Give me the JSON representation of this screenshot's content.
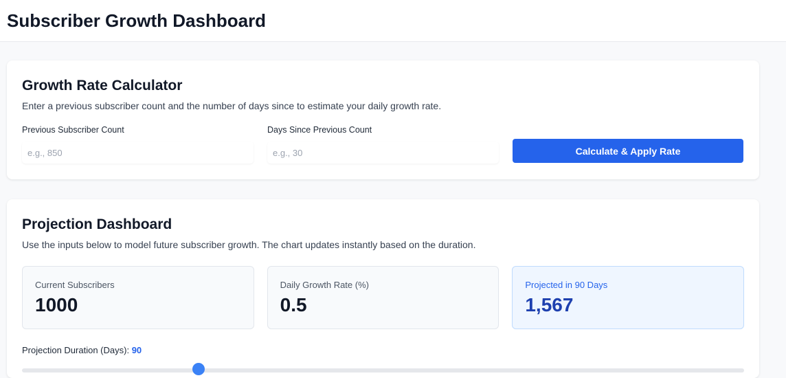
{
  "header": {
    "title": "Subscriber Growth Dashboard"
  },
  "calculator": {
    "title": "Growth Rate Calculator",
    "description": "Enter a previous subscriber count and the number of days since to estimate your daily growth rate.",
    "prev_count_label": "Previous Subscriber Count",
    "prev_count_placeholder": "e.g., 850",
    "days_label": "Days Since Previous Count",
    "days_placeholder": "e.g., 30",
    "button_label": "Calculate & Apply Rate"
  },
  "projection": {
    "title": "Projection Dashboard",
    "description": "Use the inputs below to model future subscriber growth. The chart updates instantly based on the duration.",
    "stats": [
      {
        "label": "Current Subscribers",
        "value": "1000"
      },
      {
        "label": "Daily Growth Rate (%)",
        "value": "0.5"
      },
      {
        "label": "Projected in 90 Days",
        "value": "1,567"
      }
    ],
    "duration_label": "Projection Duration (Days):",
    "duration_value": "90",
    "slider": {
      "value": 90,
      "min": 1,
      "max": 365
    },
    "accent_color": "#2563eb"
  }
}
